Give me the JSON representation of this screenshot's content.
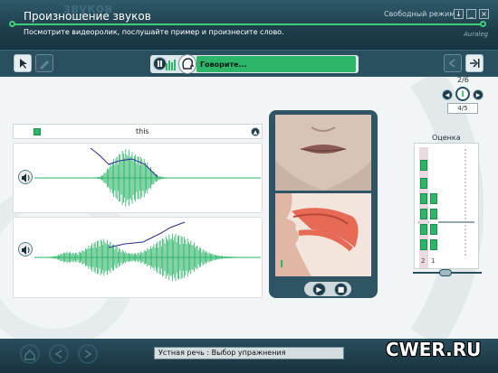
{
  "window": {
    "title": "Произношение звуков",
    "title_shadow": "звуков",
    "instruction": "Посмотрите видеоролик, послушайте пример и произнесите слово.",
    "mode": "Свободный режим",
    "brand": "Auraleg"
  },
  "toolbar": {
    "status": "Говорите..."
  },
  "exercise": {
    "word": "this",
    "counter": "2/6",
    "sub_counter": "4/5"
  },
  "score": {
    "label": "Оценка",
    "axis_left": "2",
    "axis_right": "1"
  },
  "video": {
    "marker": "I"
  },
  "footer": {
    "status": "Устная речь : Выбор упражнения"
  },
  "watermark": "CWER.RU",
  "colors": {
    "accent_green": "#2db66a",
    "title_dark": "#1e3d4b",
    "pitch_line": "#2d2d8a"
  }
}
